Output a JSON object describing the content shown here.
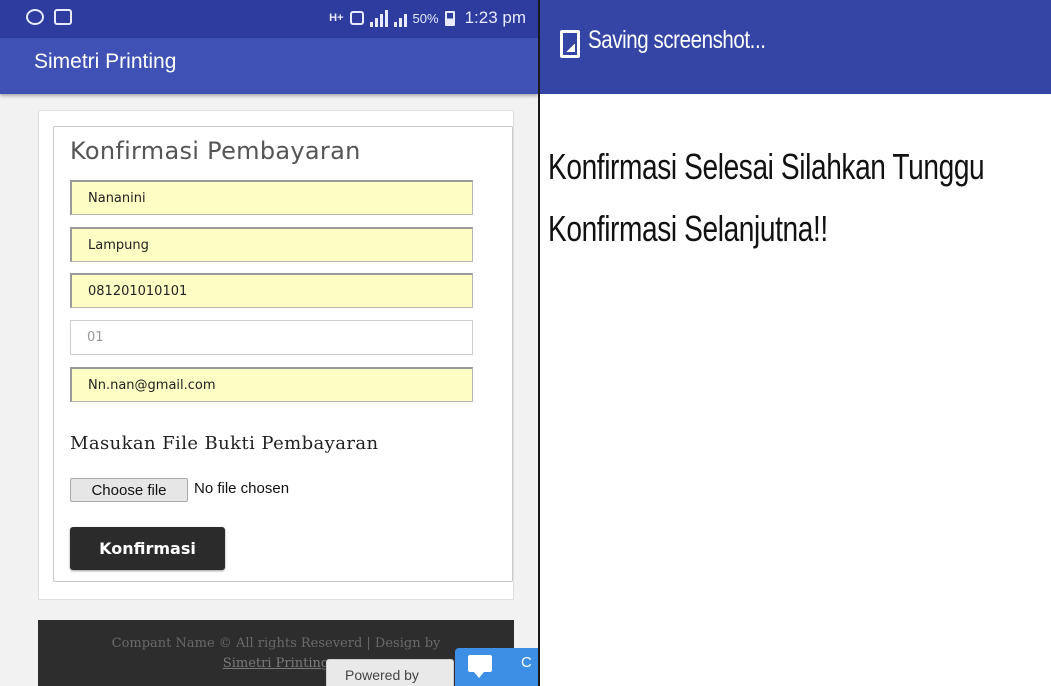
{
  "left_screen": {
    "status_bar": {
      "network_label": "H+",
      "battery_percent": "50%",
      "time": "1:23 pm"
    },
    "app_title": "Simetri Printing",
    "form": {
      "title": "Konfirmasi Pembayaran",
      "fields": {
        "name": {
          "value": "Nananini"
        },
        "city": {
          "value": "Lampung"
        },
        "phone": {
          "value": "081201010101"
        },
        "code": {
          "placeholder": "01"
        },
        "email": {
          "value": "Nn.nan@gmail.com"
        }
      },
      "file_heading": "Masukan File Bukti Pembayaran",
      "choose_file_label": "Choose file",
      "no_file_text": "No file chosen",
      "confirm_label": "Konfirmasi"
    },
    "footer": {
      "text": "Compant Name © All rights Reseverd | Design by",
      "link": "Simetri Printing"
    },
    "widgets": {
      "powered_by": "Powered by",
      "chat_label": "C"
    }
  },
  "right_screen": {
    "notification": "Saving screenshot...",
    "message": "Konfirmasi Selesai Silahkan Tunggu Konfirmasi Selanjutna!!"
  },
  "colors": {
    "status_bar": "#2d3c9e",
    "app_bar": "#3f51b5",
    "autofill_bg": "#fdfdc4",
    "confirm_button": "#2b2b2b",
    "chat_widget": "#3d8fe6"
  }
}
